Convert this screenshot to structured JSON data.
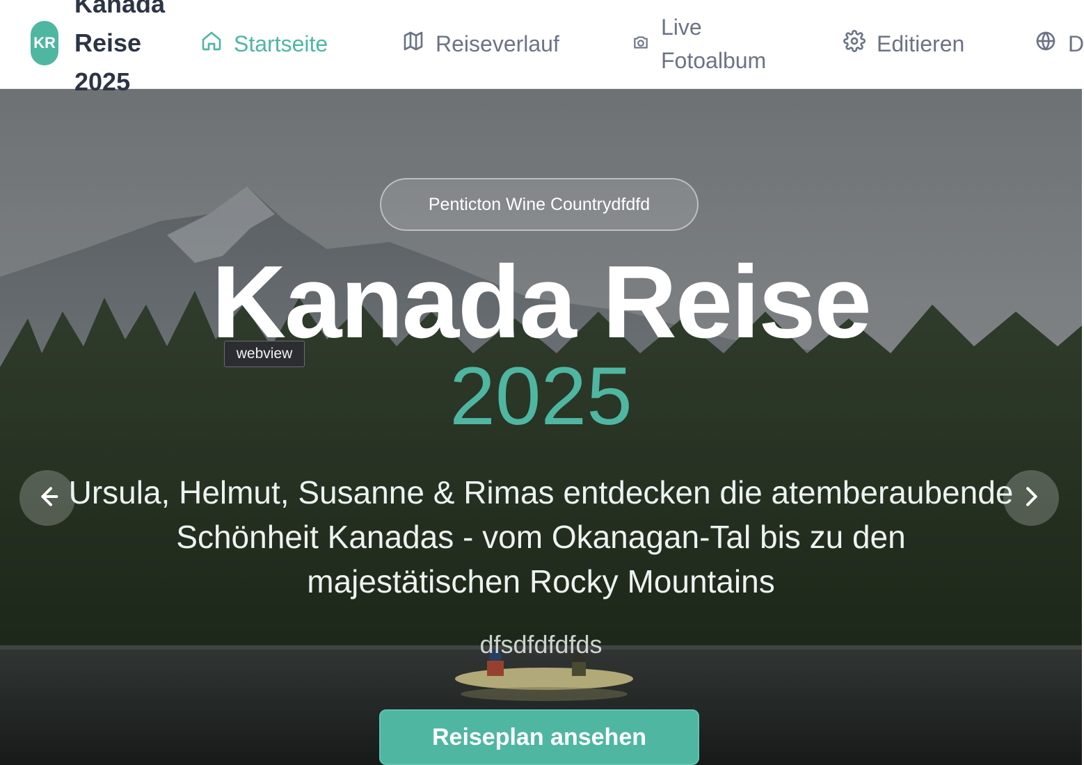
{
  "brand": {
    "initials": "KR",
    "line1": "Kanada",
    "line2": "Reise",
    "line3": "2025"
  },
  "nav": {
    "items": [
      {
        "label": "Startseite",
        "icon": "home-icon",
        "active": true
      },
      {
        "label": "Reiseverlauf",
        "icon": "map-icon",
        "active": false
      },
      {
        "label_line1": "Live",
        "label_line2": "Fotoalbum",
        "icon": "camera-icon",
        "active": false
      },
      {
        "label": "Editieren",
        "icon": "gear-icon",
        "active": false
      },
      {
        "label": "D",
        "icon": "globe-icon",
        "active": false
      }
    ]
  },
  "hero": {
    "badge": "Penticton Wine Countrydfdfd",
    "title": "Kanada Reise",
    "year": "2025",
    "subtitle_line1": "Ursula, Helmut, Susanne & Rimas entdecken die atemberaubende",
    "subtitle_line2": "Schönheit Kanadas - vom Okanagan-Tal bis zu den",
    "subtitle_line3": "majestätischen Rocky Mountains",
    "tagline": "dfsdfdfdfds",
    "cta": "Reiseplan ansehen"
  },
  "tooltip": "webview",
  "colors": {
    "accent": "#4fb6a2",
    "nav_text": "#6b7385",
    "brand_text": "#2c3445"
  }
}
